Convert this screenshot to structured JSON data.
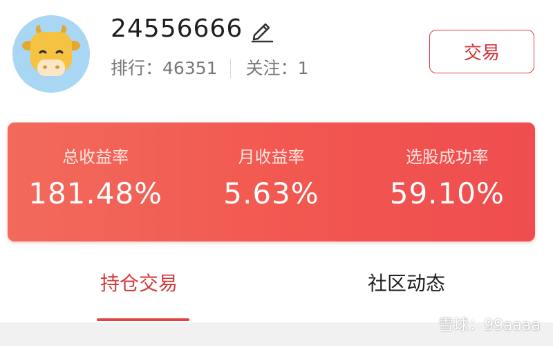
{
  "profile": {
    "username": "24556666",
    "rank_label": "排行：",
    "rank_value": "46351",
    "follow_label": "关注：",
    "follow_value": "1",
    "avatar_icon": "cow-face-icon",
    "edit_icon": "pencil-icon"
  },
  "actions": {
    "trade_button": "交易"
  },
  "stats": [
    {
      "label": "总收益率",
      "value": "181.48%"
    },
    {
      "label": "月收益率",
      "value": "5.63%"
    },
    {
      "label": "选股成功率",
      "value": "59.10%"
    }
  ],
  "tabs": [
    {
      "label": "持仓交易",
      "active": true
    },
    {
      "label": "社区动态",
      "active": false
    }
  ],
  "watermark": {
    "text": "雪球：99aaaa"
  },
  "colors": {
    "accent": "#d23a3a",
    "card_start": "#f26a5b",
    "card_end": "#ef4d4f",
    "avatar_bg": "#a9d6f3",
    "cow_yellow": "#f5c242"
  }
}
